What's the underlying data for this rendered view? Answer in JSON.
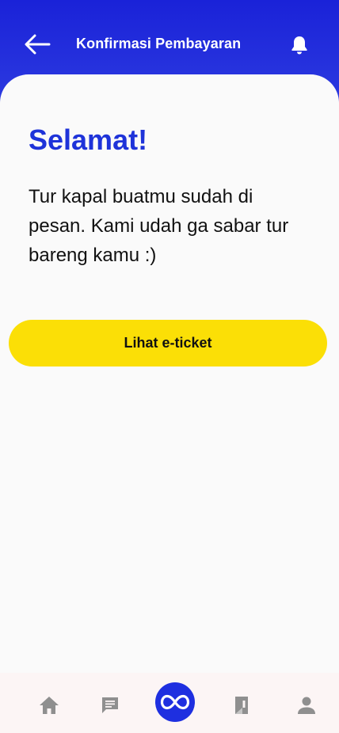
{
  "header": {
    "title": "Konfirmasi Pembayaran",
    "back_icon": "arrow-left-icon",
    "notification_icon": "bell-icon"
  },
  "content": {
    "headline": "Selamat!",
    "message": "Tur kapal buatmu sudah di pesan. Kami udah ga sabar tur bareng kamu :)",
    "eticket_button": "Lihat e-ticket"
  },
  "bottom_nav": {
    "items": [
      {
        "icon": "home-icon"
      },
      {
        "icon": "chat-icon"
      },
      {
        "icon": "infinity-icon"
      },
      {
        "icon": "receipt-icon"
      },
      {
        "icon": "profile-icon"
      }
    ]
  },
  "colors": {
    "primary": "#1e33d9",
    "accent": "#fbdf06",
    "nav_inactive": "#8f8f8f"
  }
}
